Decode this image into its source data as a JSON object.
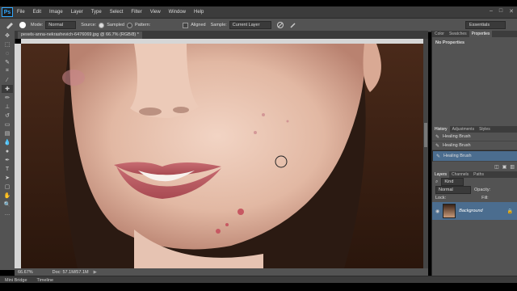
{
  "app": {
    "logo": "Ps"
  },
  "menu": [
    "File",
    "Edit",
    "Image",
    "Layer",
    "Type",
    "Select",
    "Filter",
    "View",
    "Window",
    "Help"
  ],
  "window_controls": [
    "–",
    "□",
    "✕"
  ],
  "options_bar": {
    "mode_label": "Mode:",
    "mode_value": "Normal",
    "source_label": "Source:",
    "sampled_label": "Sampled",
    "pattern_label": "Pattern:",
    "aligned_label": "Aligned",
    "sample_label": "Sample:",
    "sample_value": "Current Layer",
    "workspace": "Essentials"
  },
  "document": {
    "tab_title": "pexels-anna-nekrashevich-6476069.jpg @ 66.7% (RGB/8) *",
    "zoom": "66.67%",
    "doc_size": "Doc: 57.1M/57.1M"
  },
  "bottom_tabs": [
    "Mini Bridge",
    "Timeline"
  ],
  "panels": {
    "top_tabs": [
      "Color",
      "Swatches",
      "Properties"
    ],
    "properties_text": "No Properties",
    "history_tabs": [
      "History",
      "Adjustments",
      "Styles"
    ],
    "history_items": [
      "Healing Brush",
      "Healing Brush",
      "Healing Brush"
    ],
    "layers_tabs": [
      "Layers",
      "Channels",
      "Paths"
    ],
    "kind_label": "Kind",
    "blend_mode": "Normal",
    "opacity_label": "Opacity:",
    "lock_label": "Lock:",
    "fill_label": "Fill:",
    "layer_name": "Background"
  }
}
